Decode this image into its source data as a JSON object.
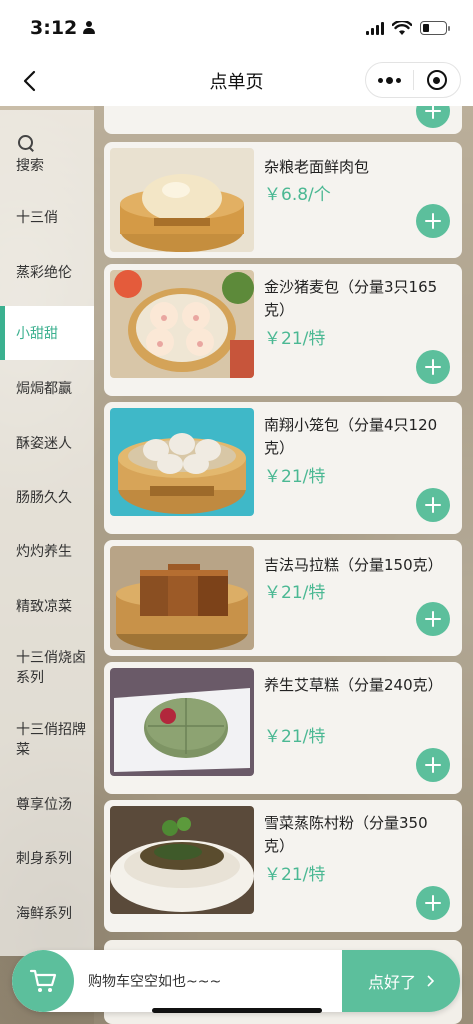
{
  "status_bar": {
    "time": "3:12"
  },
  "nav": {
    "title": "点单页"
  },
  "sidebar": {
    "search_label": "搜索",
    "items": [
      {
        "label": "十三俏"
      },
      {
        "label": "蒸彩绝伦"
      },
      {
        "label": "小甜甜",
        "active": true
      },
      {
        "label": "焗焗都赢"
      },
      {
        "label": "酥姿迷人"
      },
      {
        "label": "肠肠久久"
      },
      {
        "label": "灼灼养生"
      },
      {
        "label": "精致凉菜"
      },
      {
        "label": "十三俏烧卤\n系列"
      },
      {
        "label": "十三俏招牌\n菜"
      },
      {
        "label": "尊享位汤"
      },
      {
        "label": "刺身系列"
      },
      {
        "label": "海鲜系列"
      }
    ]
  },
  "menu": {
    "items": [
      {
        "name": "杂粮老面鲜肉包",
        "price": "￥6.8/个",
        "image": "steamed-bun"
      },
      {
        "name": "金沙猪麦包（分量3只165克）",
        "price": "￥21/特",
        "image": "piggy-buns"
      },
      {
        "name": "南翔小笼包（分量4只120克）",
        "price": "￥21/特",
        "image": "xiaolongbao"
      },
      {
        "name": "吉法马拉糕（分量150克）",
        "price": "￥21/特",
        "image": "malay-cake"
      },
      {
        "name": "养生艾草糕（分量240克）",
        "price": "￥21/特",
        "image": "mugwort-cake"
      },
      {
        "name": "雪菜蒸陈村粉（分量350克）",
        "price": "￥21/特",
        "image": "rice-noodle-rolls"
      }
    ]
  },
  "cart": {
    "empty_text": "购物车空空如也~~~",
    "checkout_label": "点好了"
  },
  "colors": {
    "accent": "#5cbf9c",
    "price": "#4bb893"
  }
}
